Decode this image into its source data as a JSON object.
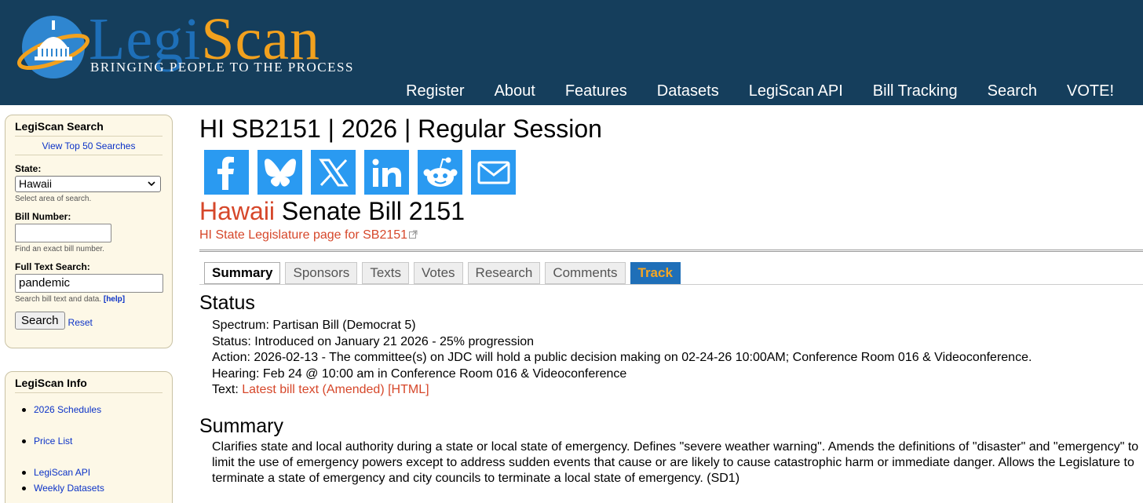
{
  "header": {
    "logo_text_part1": "Legi",
    "logo_text_part2": "Scan",
    "logo_tagline": "Bringing People to the Process",
    "nav": [
      "Register",
      "About",
      "Features",
      "Datasets",
      "LegiScan API",
      "Bill Tracking",
      "Search",
      "VOTE!"
    ]
  },
  "sidebar": {
    "search_box": {
      "title": "LegiScan Search",
      "top_searches_link": "View Top 50 Searches",
      "state_label": "State:",
      "state_value": "Hawaii",
      "state_help": "Select area of search.",
      "bill_number_label": "Bill Number:",
      "bill_number_value": "",
      "bill_number_help": "Find an exact bill number.",
      "full_text_label": "Full Text Search:",
      "full_text_value": "pandemic",
      "full_text_help": "Search bill text and data.",
      "help_link": "[help]",
      "search_button": "Search",
      "reset_link": "Reset"
    },
    "info_box": {
      "title": "LegiScan Info",
      "items": [
        "2026 Schedules",
        "Price List",
        "LegiScan API",
        "Weekly Datasets"
      ]
    }
  },
  "main": {
    "page_title": "HI SB2151 | 2026 | Regular Session",
    "share_icons": [
      "facebook-icon",
      "bluesky-icon",
      "x-icon",
      "linkedin-icon",
      "reddit-icon",
      "email-icon"
    ],
    "bill_state": "Hawaii",
    "bill_name": "Senate Bill 2151",
    "external_link": "HI State Legislature page for SB2151",
    "tabs": [
      "Summary",
      "Sponsors",
      "Texts",
      "Votes",
      "Research",
      "Comments",
      "Track"
    ],
    "status_heading": "Status",
    "status": {
      "spectrum": "Spectrum: Partisan Bill (Democrat 5)",
      "status": "Status: Introduced on January 21 2026 - 25% progression",
      "action": "Action: 2026-02-13 - The committee(s) on JDC will hold a public decision making on 02-24-26 10:00AM; Conference Room 016 & Videoconference.",
      "hearing": "Hearing: Feb 24 @ 10:00 am in Conference Room 016 & Videoconference",
      "text_label": "Text: ",
      "text_link": "Latest bill text (Amended) [HTML]"
    },
    "summary_heading": "Summary",
    "summary_text": "Clarifies state and local authority during a state or local state of emergency. Defines \"severe weather warning\". Amends the definitions of \"disaster\" and \"emergency\" to limit the use of emergency powers except to address sudden events that cause or are likely to cause catastrophic harm or immediate danger. Allows the Legislature to terminate a state of emergency and city councils to terminate a local state of emergency. (SD1)"
  },
  "colors": {
    "header_bg": "#153e5c",
    "accent_red": "#d6472a",
    "link_blue": "#0b32c7",
    "share_blue": "#2a9af1",
    "track_bg": "#1f6fb8",
    "track_text": "#f5a623",
    "sidebar_bg": "#fdf8e7"
  }
}
